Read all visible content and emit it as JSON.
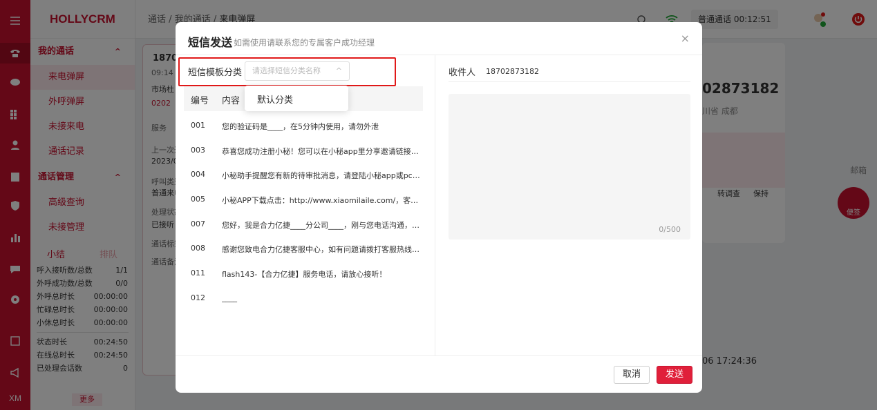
{
  "app": {
    "brand": "HOLLYCRM",
    "rail_bottom": "XM"
  },
  "breadcrumb": {
    "a": "通话",
    "b": "我的通话",
    "c": "来电弹屏",
    "sep": "/"
  },
  "topbar": {
    "call_status": "普通通话 00:12:51"
  },
  "sidebar": {
    "group1": "我的通话",
    "items1": [
      "来电弹屏",
      "外呼弹屏",
      "未接来电",
      "通话记录"
    ],
    "group2": "通话管理",
    "items2": [
      "高级查询",
      "未接管理"
    ],
    "tab_summary": "小结",
    "tab_queue": "排队",
    "stats": [
      {
        "k": "呼入接听数/总数",
        "v": "1/1"
      },
      {
        "k": "外呼成功数/总数",
        "v": "0/0"
      },
      {
        "k": "外呼总时长",
        "v": "00:00:00"
      },
      {
        "k": "忙碌总时长",
        "v": "00:00:00"
      },
      {
        "k": "小休总时长",
        "v": "00:00:00"
      }
    ],
    "stats2": [
      {
        "k": "状态时长",
        "v": "00:24:50"
      },
      {
        "k": "在线总时长",
        "v": "00:24:50"
      },
      {
        "k": "已处理会话数",
        "v": "0"
      }
    ],
    "more": "更多"
  },
  "base_left": {
    "num": "1870",
    "time": "09:14",
    "l1": "市场杜",
    "l2": "0202",
    "l3": "服务",
    "l4": "上一次通",
    "l5": "2023/0",
    "l6": "呼叫类型",
    "l7": "普通来电",
    "l8": "处理状态",
    "l9": "已接听",
    "l10": "通话标签",
    "l11": "通话备注"
  },
  "base_right": {
    "phone": "02873182",
    "loc": "川省 成都",
    "act1": "转调查",
    "act2": "保持",
    "mail": "邮箱",
    "date": "06 17:24:36",
    "note": "便签"
  },
  "modal": {
    "title": "短信发送",
    "subtitle": "如需使用请联系您的专属客户成功经理",
    "close": "×",
    "category_label": "短信模板分类",
    "category_placeholder": "请选择短信分类名称",
    "dropdown_option": "默认分类",
    "col_code": "编号",
    "col_content": "内容",
    "templates": [
      {
        "code": "001",
        "content": "您的验证码是____，在5分钟内使用，请勿外泄"
      },
      {
        "code": "003",
        "content": "恭喜您成功注册小秘！您可以在小秘app里分享邀请链接到好友"
      },
      {
        "code": "004",
        "content": "小秘助手提醒您有新的待审批消息，请登陆小秘app或pc端查看"
      },
      {
        "code": "005",
        "content": "小秘APP下载点击：http://www.xiaomilaile.com/，客服电话"
      },
      {
        "code": "007",
        "content": "您好，我是合力亿捷____分公司____，刚与您电话沟通，期待合作"
      },
      {
        "code": "008",
        "content": "感谢您致电合力亿捷客服中心，如有问题请拨打客服热线4008"
      },
      {
        "code": "011",
        "content": "flash143-【合力亿捷】服务电话，请放心接听！"
      },
      {
        "code": "012",
        "content": "____"
      }
    ],
    "recipient_label": "收件人",
    "recipient_value": "18702873182",
    "char_count": "0/500",
    "cancel": "取消",
    "send": "发送"
  }
}
